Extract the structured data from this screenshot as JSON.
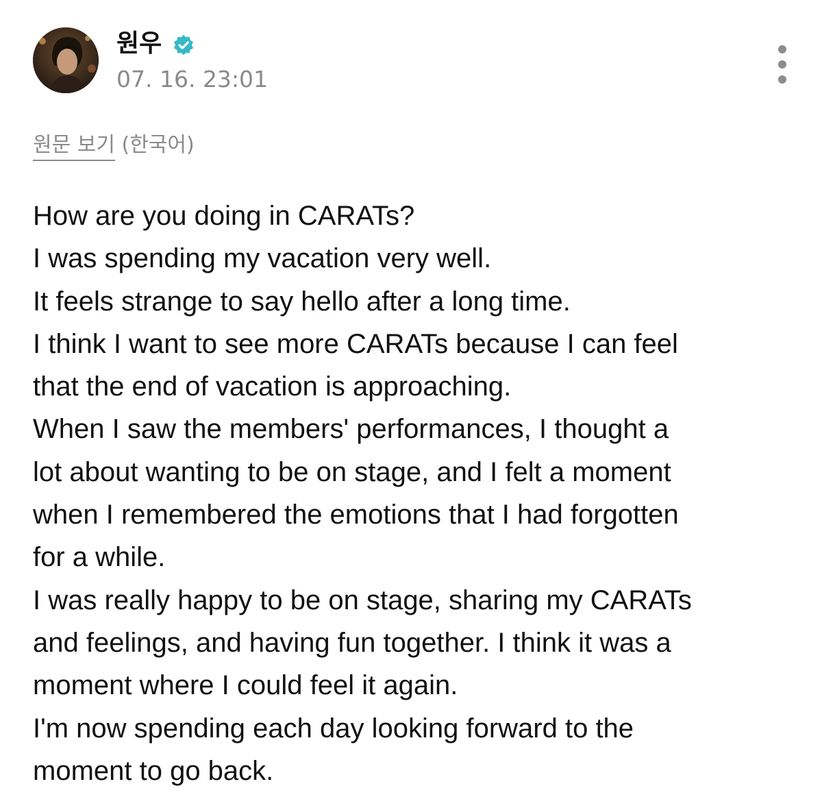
{
  "post": {
    "author": "원우",
    "verified_icon": "verified-badge-icon",
    "timestamp": "07. 16. 23:01",
    "more_icon": "more-vertical-icon",
    "translate_link_label": "원문 보기",
    "translate_language": "(한국어)",
    "body_lines": [
      "How are you doing in CARATs?",
      "I was spending my vacation very well.",
      "It feels strange to say hello after a long time.",
      "I think I want to see more CARATs because I can feel",
      "that the end of vacation is approaching.",
      "When I saw the members' performances, I thought a",
      "lot about wanting to be on stage, and I felt a moment",
      "when I remembered the emotions that I had forgotten",
      "for a while.",
      "I was really happy to be on stage, sharing my CARATs",
      "and feelings, and having fun together. I think it was a",
      "moment where I could feel it again.",
      "I'm now spending each day looking forward to the",
      "moment to go back."
    ]
  },
  "colors": {
    "text": "#111111",
    "muted": "#8a8a8a",
    "verified": "#35b8c8"
  }
}
